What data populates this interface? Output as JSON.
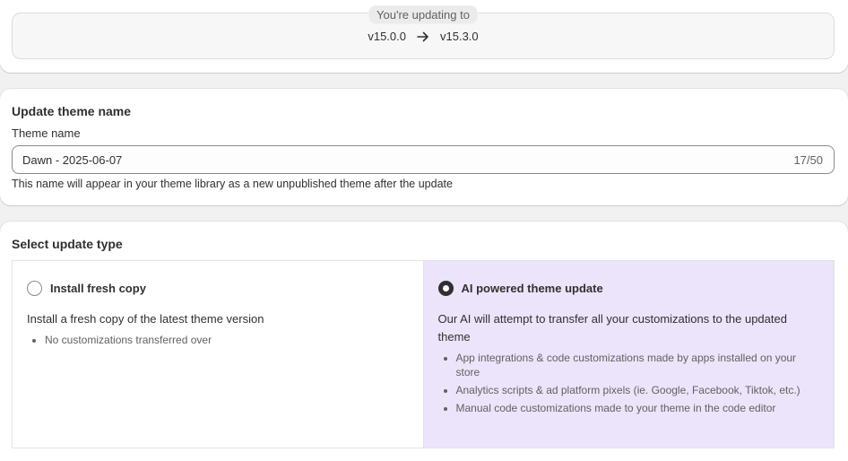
{
  "version": {
    "pill_label": "You're updating to",
    "from": "v15.0.0",
    "to": "v15.3.0"
  },
  "theme_name": {
    "section_title": "Update theme name",
    "field_label": "Theme name",
    "value": "Dawn - 2025-06-07",
    "char_count": "17/50",
    "help_text": "This name will appear in your theme library as a new unpublished theme after the update"
  },
  "update_type": {
    "section_title": "Select update type",
    "options": [
      {
        "title": "Install fresh copy",
        "selected": false,
        "description": "Install a fresh copy of the latest theme version",
        "bullets": [
          "No customizations transferred over"
        ]
      },
      {
        "title": "AI powered theme update",
        "selected": true,
        "description": "Our AI will attempt to transfer all your customizations to the updated theme",
        "bullets": [
          "App integrations & code customizations made by apps installed on your store",
          "Analytics scripts & ad platform pixels (ie. Google, Facebook, Tiktok, etc.)",
          "Manual code customizations made to your theme in the code editor"
        ]
      }
    ]
  },
  "colors": {
    "background": "#f1f1f1",
    "card": "#ffffff",
    "ai_option_bg": "#ebe4fb",
    "text": "#303030",
    "muted_text": "#616161"
  },
  "icons": [
    "arrow-right-icon"
  ]
}
